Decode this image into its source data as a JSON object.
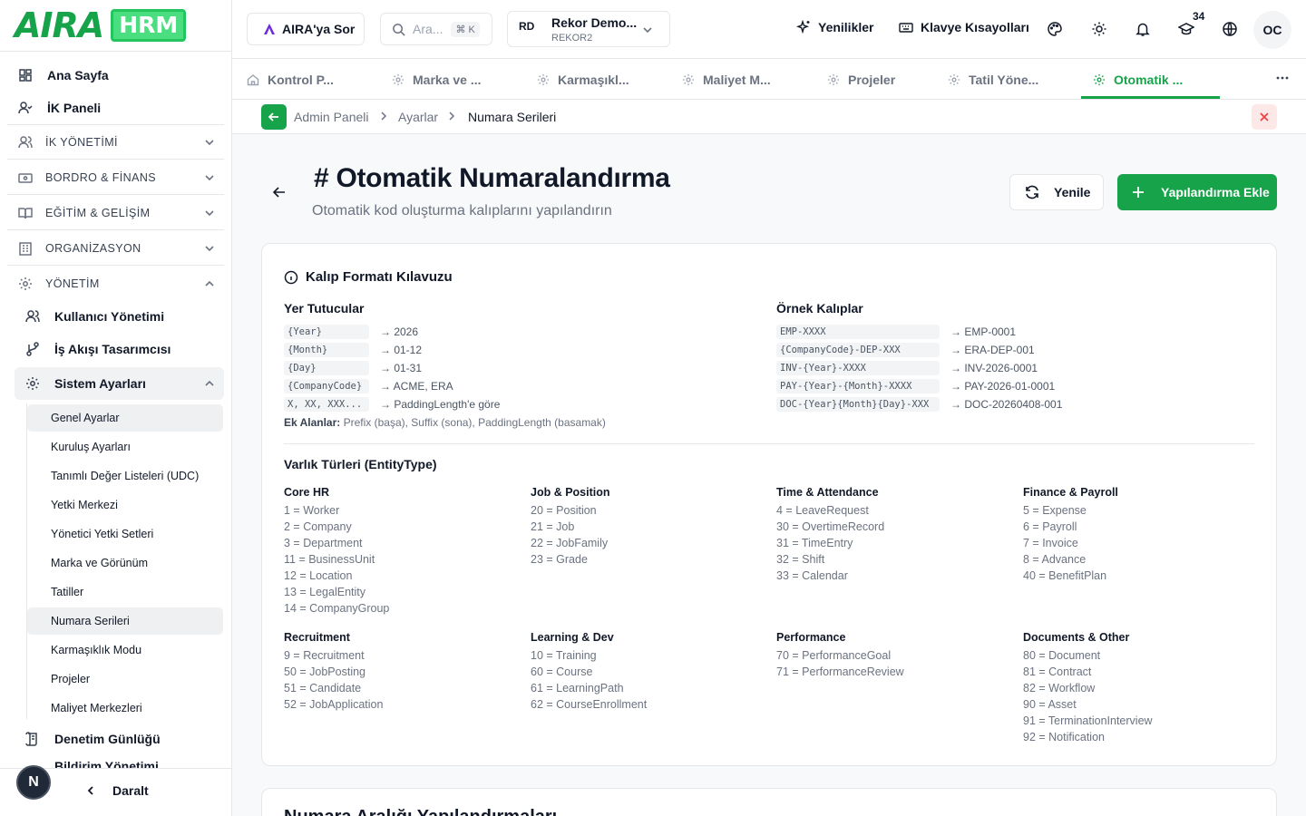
{
  "brand": {
    "logo_text": "AIRA",
    "logo_badge": "HRM",
    "accent": "#16a34a"
  },
  "sidebar": {
    "items": [
      {
        "label": "Ana Sayfa",
        "icon": "dashboard-icon"
      },
      {
        "label": "İK Paneli",
        "icon": "user-check-icon"
      }
    ],
    "sections": [
      {
        "label": "İK YÖNETİMİ",
        "icon": "users-icon"
      },
      {
        "label": "BORDRO & FİNANS",
        "icon": "wallet-icon"
      },
      {
        "label": "EĞİTİM & GELİŞİM",
        "icon": "book-icon"
      },
      {
        "label": "ORGANİZASYON",
        "icon": "building-icon"
      },
      {
        "label": "YÖNETİM",
        "icon": "gear-icon"
      }
    ],
    "management": [
      {
        "label": "Kullanıcı Yönetimi",
        "icon": "users-icon"
      },
      {
        "label": "İş Akışı Tasarımcısı",
        "icon": "workflow-icon"
      },
      {
        "label": "Sistem Ayarları",
        "icon": "gear-icon"
      }
    ],
    "system_settings": [
      "Genel Ayarlar",
      "Kuruluş Ayarları",
      "Tanımlı Değer Listeleri (UDC)",
      "Yetki Merkezi",
      "Yönetici Yetki Setleri",
      "Marka ve Görünüm",
      "Tatiller",
      "Numara Serileri",
      "Karmaşıklık Modu",
      "Projeler",
      "Maliyet Merkezleri"
    ],
    "audit": "Denetim Günlüğü",
    "partial_item": "Bildirim Yönetimi",
    "collapse_label": "Daralt",
    "n_badge": "N"
  },
  "topbar": {
    "ask_label": "AIRA'ya Sor",
    "search_placeholder": "Ara...",
    "search_kbd": "⌘ K",
    "tenant_avatar": "RD",
    "tenant_name": "Rekor Demo...",
    "tenant_code": "REKOR2",
    "news_label": "Yenilikler",
    "shortcuts_label": "Klavye Kısayolları",
    "notif_count": "34",
    "user_initials": "OC"
  },
  "tabs": [
    {
      "label": "Kontrol P...",
      "icon": "home-icon"
    },
    {
      "label": "Marka ve ...",
      "icon": "gear-icon"
    },
    {
      "label": "Karmaşıkl...",
      "icon": "gear-icon"
    },
    {
      "label": "Maliyet M...",
      "icon": "gear-icon"
    },
    {
      "label": "Projeler",
      "icon": "gear-icon"
    },
    {
      "label": "Tatil Yöne...",
      "icon": "gear-icon"
    },
    {
      "label": "Otomatik ...",
      "icon": "gear-icon",
      "active": true
    }
  ],
  "breadcrumb": [
    "Admin Paneli",
    "Ayarlar",
    "Numara Serileri"
  ],
  "header": {
    "title": "Otomatik Numaralandırma",
    "title_icon": "#",
    "subtitle": "Otomatik kod oluşturma kalıplarını yapılandırın",
    "refresh_label": "Yenile",
    "add_label": "Yapılandırma Ekle"
  },
  "guide": {
    "title": "Kalıp Formatı Kılavuzu",
    "placeholders_title": "Yer Tutucular",
    "placeholders": [
      {
        "code": "{Year}",
        "result": "→ 2026"
      },
      {
        "code": "{Month}",
        "result": "→ 01-12"
      },
      {
        "code": "{Day}",
        "result": "→ 01-31"
      },
      {
        "code": "{CompanyCode}",
        "result": "→ ACME, ERA"
      },
      {
        "code": "X, XX, XXX...",
        "result": "→ PaddingLength'e göre"
      }
    ],
    "extra_label": "Ek Alanlar:",
    "extra_text": "Prefix (başa), Suffix (sona), PaddingLength (basamak)",
    "examples_title": "Örnek Kalıplar",
    "examples": [
      {
        "code": "EMP-XXXX",
        "result": "→ EMP-0001"
      },
      {
        "code": "{CompanyCode}-DEP-XXX",
        "result": "→ ERA-DEP-001"
      },
      {
        "code": "INV-{Year}-XXXX",
        "result": "→ INV-2026-0001"
      },
      {
        "code": "PAY-{Year}-{Month}-XXXX",
        "result": "→ PAY-2026-01-0001"
      },
      {
        "code": "DOC-{Year}{Month}{Day}-XXX",
        "result": "→ DOC-20260408-001"
      }
    ],
    "entity_title": "Varlık Türleri (EntityType)",
    "entity_groups": [
      {
        "name": "Core HR",
        "items": [
          "1 = Worker",
          "2 = Company",
          "3 = Department",
          "11 = BusinessUnit",
          "12 = Location",
          "13 = LegalEntity",
          "14 = CompanyGroup"
        ]
      },
      {
        "name": "Job & Position",
        "items": [
          "20 = Position",
          "21 = Job",
          "22 = JobFamily",
          "23 = Grade"
        ]
      },
      {
        "name": "Time & Attendance",
        "items": [
          "4 = LeaveRequest",
          "30 = OvertimeRecord",
          "31 = TimeEntry",
          "32 = Shift",
          "33 = Calendar"
        ]
      },
      {
        "name": "Finance & Payroll",
        "items": [
          "5 = Expense",
          "6 = Payroll",
          "7 = Invoice",
          "8 = Advance",
          "40 = BenefitPlan"
        ]
      },
      {
        "name": "Recruitment",
        "items": [
          "9 = Recruitment",
          "50 = JobPosting",
          "51 = Candidate",
          "52 = JobApplication"
        ]
      },
      {
        "name": "Learning & Dev",
        "items": [
          "10 = Training",
          "60 = Course",
          "61 = LearningPath",
          "62 = CourseEnrollment"
        ]
      },
      {
        "name": "Performance",
        "items": [
          "70 = PerformanceGoal",
          "71 = PerformanceReview"
        ]
      },
      {
        "name": "Documents & Other",
        "items": [
          "80 = Document",
          "81 = Contract",
          "82 = Workflow",
          "90 = Asset",
          "91 = TerminationInterview",
          "92 = Notification"
        ]
      }
    ]
  },
  "next_card_title": "Numara Aralığı Yapılandırmaları"
}
